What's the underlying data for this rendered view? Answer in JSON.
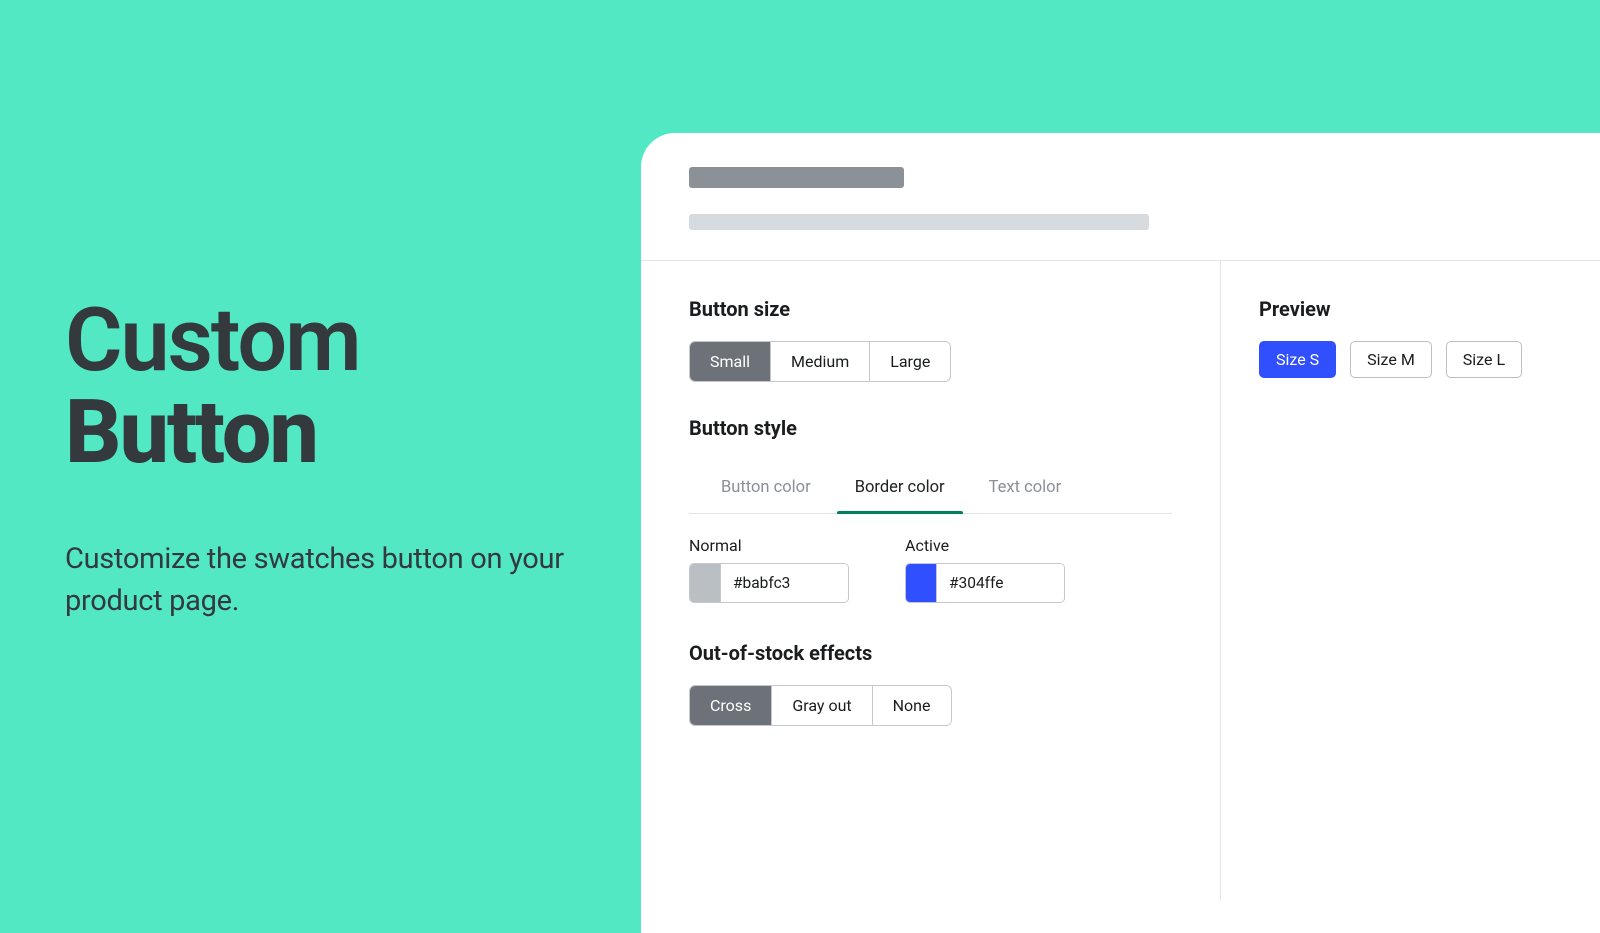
{
  "hero": {
    "title_line1": "Custom",
    "title_line2": "Button",
    "subtitle": "Customize the swatches button on your product page."
  },
  "settings": {
    "button_size_heading": "Button size",
    "sizes": {
      "small": "Small",
      "medium": "Medium",
      "large": "Large"
    },
    "button_style_heading": "Button style",
    "tabs": {
      "button_color": "Button color",
      "border_color": "Border color",
      "text_color": "Text color"
    },
    "normal_label": "Normal",
    "active_label": "Active",
    "normal_color": "#babfc3",
    "active_color": "#304ffe",
    "out_of_stock_heading": "Out-of-stock effects",
    "effects": {
      "cross": "Cross",
      "gray_out": "Gray out",
      "none": "None"
    }
  },
  "preview": {
    "heading": "Preview",
    "sizes": {
      "s": "Size S",
      "m": "Size M",
      "l": "Size L"
    }
  },
  "colors": {
    "accent_mint": "#52e8c4",
    "hero_text": "#33393c",
    "seg_active_bg": "#6d7278",
    "tab_active_underline": "#008060",
    "normal_swatch": "#babfc3",
    "active_swatch": "#304ffe",
    "preview_primary": "#304ffe"
  }
}
